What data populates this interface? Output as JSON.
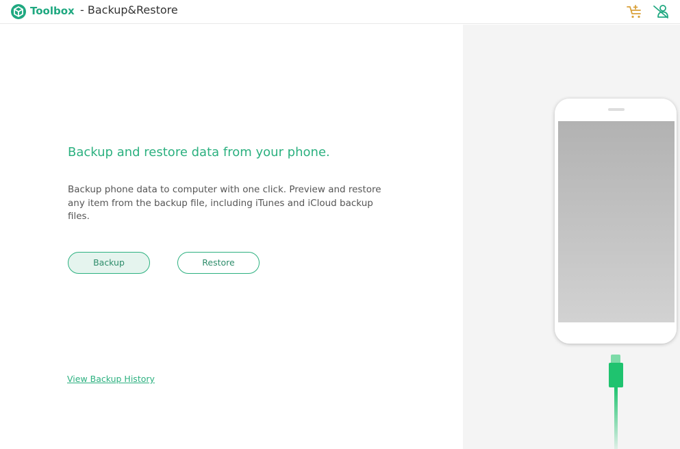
{
  "header": {
    "brand": "Toolbox",
    "title": "- Backup&Restore",
    "icons": [
      "toolbox-logo-icon",
      "cart-icon",
      "user-remove-icon"
    ]
  },
  "main": {
    "headline": "Backup and restore data from your phone.",
    "description": "Backup phone data to computer with one click. Preview and restore any item from the backup file, including iTunes and iCloud backup files.",
    "backup_label": "Backup",
    "restore_label": "Restore",
    "history_link": "View Backup History"
  },
  "colors": {
    "accent": "#2bb07f",
    "brand": "#1fa880",
    "cart_icon": "#d9a13a",
    "panel_bg": "#f4f4f4",
    "cable": "#1fc36f"
  }
}
